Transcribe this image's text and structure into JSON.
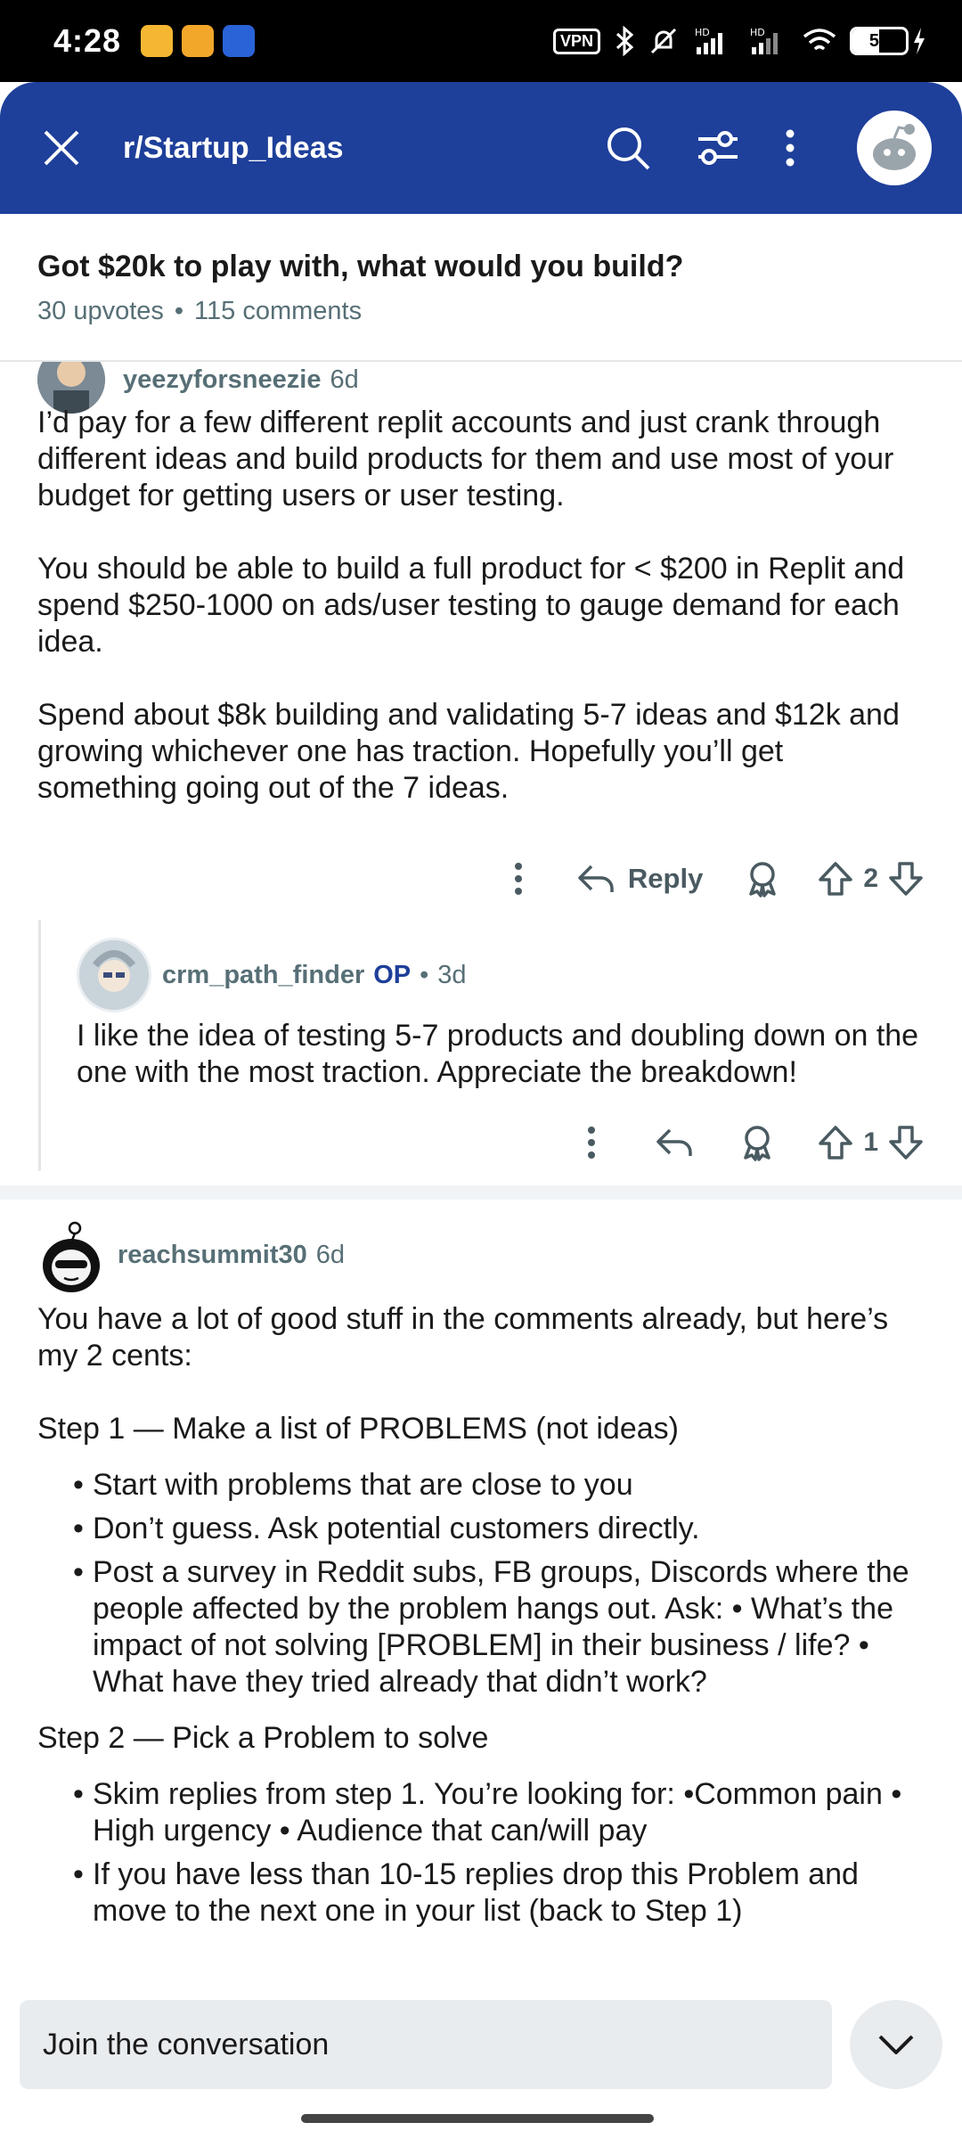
{
  "status_bar": {
    "time": "4:28",
    "vpn": "VPN",
    "battery": "50",
    "battery_level": 0.5,
    "app_icon_colors": [
      "#f5b731",
      "#f3a72a",
      "#2a63d8"
    ]
  },
  "header": {
    "title": "r/Startup_Ideas",
    "close_icon": "close-icon",
    "search_icon": "search-icon",
    "sort_icon": "sort-filter-icon",
    "more_icon": "more-vertical-icon",
    "accent_color": "#1e3f9a"
  },
  "post": {
    "title": "Got $20k to play with, what would you build?",
    "upvotes": "30 upvotes",
    "comments": "115 comments",
    "separator": "•"
  },
  "comments": [
    {
      "author": "yeezyforsneezie",
      "age": "6d",
      "paragraphs": [
        "I’d pay for a few different replit accounts and just crank through different ideas and build products for them and use most of your budget for getting users or user testing.",
        "You should be able to build a full product for < $200 in Replit and spend $250-1000 on ads/user testing to gauge demand for each idea.",
        "Spend about $8k building and validating 5-7 ideas and $12k and growing whichever one has traction. Hopefully you’ll get something going out of the 7 ideas."
      ],
      "reply_label": "Reply",
      "votes": "2"
    },
    {
      "author": "crm_path_finder",
      "op_tag": "OP",
      "age_prefix": "•",
      "age": "3d",
      "text": "I like the idea of testing 5-7 products and doubling down on the one with the most traction. Appreciate the breakdown!",
      "votes": "1"
    },
    {
      "author": "reachsummit30",
      "age": "6d",
      "intro": "You have a lot of good stuff in the comments already, but here’s my 2 cents:",
      "step1_title": "Step 1 — Make a list of PROBLEMS (not ideas)",
      "step1_items": [
        "Start with problems that are close to you",
        "Don’t guess. Ask potential customers directly.",
        "Post a survey in Reddit subs, FB groups, Discords where the people affected by the problem hangs out. Ask: • What’s the impact of not solving [PROBLEM] in their business / life? • What have they tried already that didn’t work?"
      ],
      "step2_title": "Step 2 — Pick a Problem to solve",
      "step2_items": [
        "Skim replies from step 1. You’re looking for: •Common pain • High urgency • Audience that can/will pay",
        "If you have less than 10-15 replies drop this Problem and move to the next one in your list (back to Step 1)"
      ]
    }
  ],
  "composer": {
    "placeholder": "Join the conversation",
    "collapse_icon": "chevron-down-icon"
  }
}
